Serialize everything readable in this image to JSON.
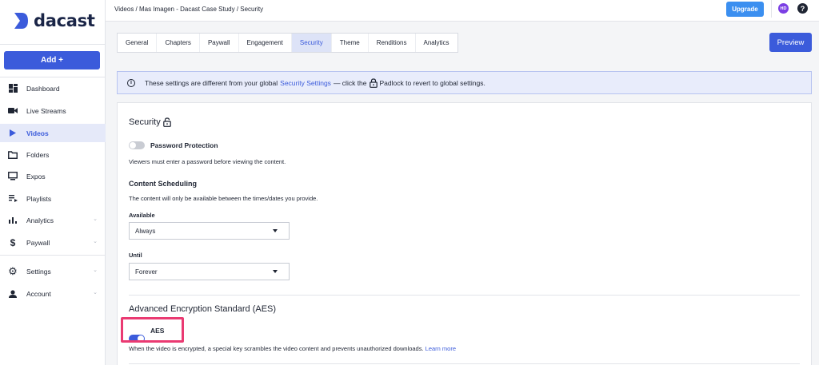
{
  "brand": {
    "name": "dacast",
    "color": "#3b5bdb"
  },
  "sidebar": {
    "add_label": "Add +",
    "items": [
      {
        "label": "Dashboard",
        "icon": "dashboard-icon",
        "chevron": false,
        "active": false
      },
      {
        "label": "Live Streams",
        "icon": "camera-icon",
        "chevron": false,
        "active": false
      },
      {
        "label": "Videos",
        "icon": "play-icon",
        "chevron": false,
        "active": true
      },
      {
        "label": "Folders",
        "icon": "folder-icon",
        "chevron": false,
        "active": false
      },
      {
        "label": "Expos",
        "icon": "monitor-icon",
        "chevron": false,
        "active": false
      },
      {
        "label": "Playlists",
        "icon": "playlist-icon",
        "chevron": false,
        "active": false
      },
      {
        "label": "Analytics",
        "icon": "bar-chart-icon",
        "chevron": true,
        "active": false
      },
      {
        "label": "Paywall",
        "icon": "dollar-icon",
        "chevron": true,
        "active": false
      },
      {
        "label": "Settings",
        "icon": "gear-icon",
        "chevron": true,
        "active": false
      },
      {
        "label": "Account",
        "icon": "person-icon",
        "chevron": true,
        "active": false
      }
    ]
  },
  "topbar": {
    "breadcrumb": "Videos  /  Mas Imagen - Dacast Case Study  /  Security",
    "upgrade_label": "Upgrade",
    "avatar_initials": "HD",
    "help_glyph": "?"
  },
  "tabs": {
    "items": [
      "General",
      "Chapters",
      "Paywall",
      "Engagement",
      "Security",
      "Theme",
      "Renditions",
      "Analytics"
    ],
    "active": "Security",
    "preview_label": "Preview"
  },
  "banner": {
    "info_glyph": "i",
    "text_before": "These settings are different from your global",
    "link": "Security Settings",
    "text_middle": "— click the",
    "text_after": "Padlock to revert to global settings."
  },
  "security": {
    "title": "Security",
    "password_label": "Password Protection",
    "password_enabled": false,
    "password_desc": "Viewers must enter a password before viewing the content.",
    "scheduling_title": "Content Scheduling",
    "scheduling_desc": "The content will only be available between the times/dates you provide.",
    "available_label": "Available",
    "available_value": "Always",
    "until_label": "Until",
    "until_value": "Forever"
  },
  "aes": {
    "title": "Advanced Encryption Standard (AES)",
    "label": "AES",
    "enabled": true,
    "desc": "When the video is encrypted, a special key scrambles the video content and prevents unauthorized downloads.",
    "link": "Learn more"
  }
}
